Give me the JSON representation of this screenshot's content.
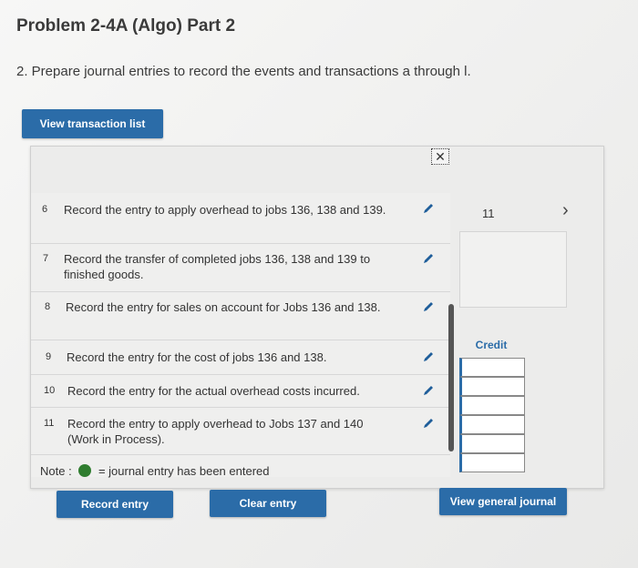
{
  "page": {
    "title": "Problem 2-4A (Algo) Part 2",
    "instruction": "2. Prepare journal entries to record the events and transactions a through l."
  },
  "buttons": {
    "view_transaction_list": "View transaction list",
    "record_entry": "Record entry",
    "clear_entry": "Clear entry",
    "view_general_journal": "View general journal"
  },
  "panel": {
    "close_icon": "close-icon",
    "entry_number": "11",
    "next_icon": "›",
    "credit_header": "Credit"
  },
  "transactions": [
    {
      "num": "6",
      "text": "Record the entry to apply overhead to jobs 136, 138 and 139."
    },
    {
      "num": "7",
      "text": "Record the transfer of completed jobs 136, 138 and 139 to finished goods."
    },
    {
      "num": "8",
      "text": "Record the entry for sales on account for Jobs 136 and 138."
    },
    {
      "num": "9",
      "text": "Record the entry for the cost of jobs 136 and 138."
    },
    {
      "num": "10",
      "text": "Record the entry for the actual overhead costs incurred."
    },
    {
      "num": "11",
      "text": "Record the entry to apply overhead to Jobs 137 and 140 (Work in Process)."
    }
  ],
  "note": {
    "prefix": "Note :",
    "suffix": "= journal entry has been entered"
  },
  "colors": {
    "accent": "#2b6ca8",
    "entered": "#2f7d2f"
  }
}
